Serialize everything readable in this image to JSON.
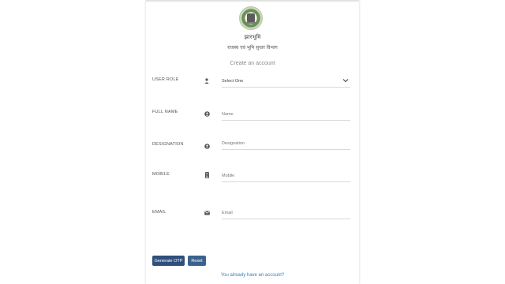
{
  "brand": {
    "title_line1": "झारभूमि",
    "title_line2": "राजस्व एवं भूमि सुधार विभाग"
  },
  "form": {
    "heading": "Create an account",
    "fields": [
      {
        "label": "USER ROLE",
        "icon": "user-icon",
        "type": "select",
        "value": "Select One"
      },
      {
        "label": "FULL NAME",
        "icon": "account-circle-icon",
        "type": "text",
        "placeholder": "Name"
      },
      {
        "label": "DESIGNATION",
        "icon": "account-circle-icon",
        "type": "text",
        "placeholder": "Designation"
      },
      {
        "label": "MOBILE",
        "icon": "mobile-phone-icon",
        "type": "text",
        "placeholder": "Mobile"
      },
      {
        "label": "EMAIL",
        "icon": "envelope-icon",
        "type": "text",
        "placeholder": "Email"
      }
    ],
    "buttons": {
      "generate_otp": "Generate OTP",
      "reset": "Reset"
    },
    "login_link": "You already have an account?"
  },
  "colors": {
    "primary_button": "#2f4f7d",
    "secondary_button": "#3b628f",
    "link": "#2f86c6"
  }
}
